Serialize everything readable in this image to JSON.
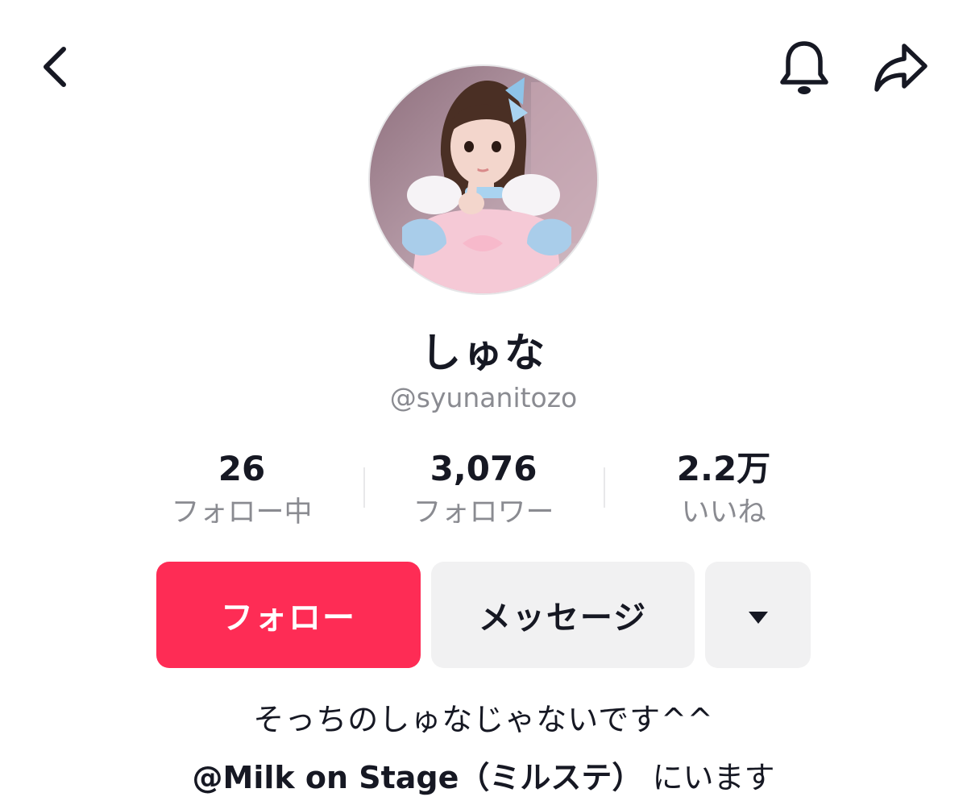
{
  "header": {
    "back_icon": "chevron-left-icon",
    "bell_icon": "bell-icon",
    "share_icon": "share-arrow-icon"
  },
  "profile": {
    "display_name": "しゅな",
    "username": "@syunanitozo"
  },
  "stats": [
    {
      "value": "26",
      "label": "フォロー中"
    },
    {
      "value": "3,076",
      "label": "フォロワー"
    },
    {
      "value": "2.2万",
      "label": "いいね"
    }
  ],
  "actions": {
    "follow_label": "フォロー",
    "message_label": "メッセージ",
    "more_icon": "caret-down-icon"
  },
  "bio": {
    "line1": "そっちのしゅなじゃないです^^",
    "mention": "@Milk on Stage（ミルステ）",
    "line2_suffix": " にいます"
  },
  "colors": {
    "follow_button": "#fe2c55",
    "secondary_button": "#f1f1f2",
    "muted_text": "#8a8b91",
    "primary_text": "#161823"
  }
}
